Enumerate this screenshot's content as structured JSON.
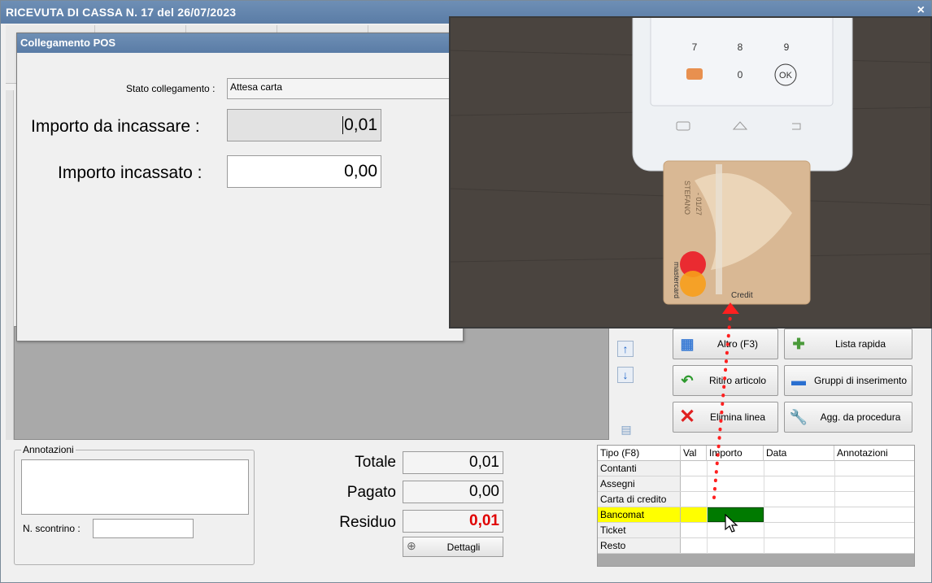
{
  "window": {
    "title": "RICEVUTA DI CASSA N. 17 del 26/07/2023",
    "close_glyph": "×"
  },
  "pos_dialog": {
    "title": "Collegamento POS",
    "stato_label": "Stato collegamento :",
    "stato_value": "Attesa carta",
    "da_incassare_label": "Importo da incassare :",
    "da_incassare_value": "0,01",
    "incassato_label": "Importo incassato :",
    "incassato_value": "0,00"
  },
  "video": {
    "keypad_keys": [
      "7",
      "8",
      "9",
      "0",
      "OK"
    ],
    "card_text_lines": [
      "- 01/27",
      "STEFANO"
    ],
    "card_brand": "mastercard",
    "card_type": "Credit",
    "colors": {
      "table_wood": "#4a443f",
      "card": "#d9b894",
      "arrow": "#ff2020"
    }
  },
  "actions": {
    "altro": "Altro (F3)",
    "lista_rapida": "Lista rapida",
    "ritiro_articolo": "Ritiro articolo",
    "gruppi_inserimento": "Gruppi di inserimento",
    "elimina_linea": "Elimina linea",
    "agg_procedura": "Agg. da procedura"
  },
  "annotations": {
    "legend": "Annotazioni",
    "scontrino_label": "N. scontrino :"
  },
  "totals": {
    "totale_label": "Totale",
    "totale_value": "0,01",
    "pagato_label": "Pagato",
    "pagato_value": "0,00",
    "residuo_label": "Residuo",
    "residuo_value": "0,01",
    "dettagli_label": "Dettagli"
  },
  "payments": {
    "headers": [
      "Tipo (F8)",
      "Val",
      "Importo",
      "Data",
      "Annotazioni"
    ],
    "rows": [
      "Contanti",
      "Assegni",
      "Carta di credito",
      "Bancomat",
      "Ticket",
      "Resto"
    ],
    "active_row": "Bancomat",
    "highlight_color": "#ffff00",
    "selected_cell_color": "#007a00"
  }
}
